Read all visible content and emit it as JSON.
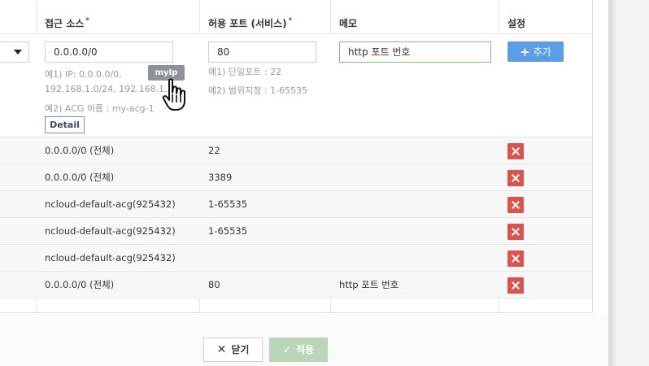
{
  "table": {
    "headers": {
      "source": "접근 소스",
      "port": "허용 포트 (서비스)",
      "memo": "메모",
      "settings": "설정"
    },
    "required_marker": "•"
  },
  "input_row": {
    "source_value": "0.0.0.0/0",
    "port_value": "80",
    "memo_value": "http 포트 번호",
    "source_hints": [
      "예1) IP: 0.0.0.0/0,",
      "192.168.1.0/24, 192.168.1.7",
      "예2) ACG 이름 : my-acg-1"
    ],
    "port_hints": [
      "예1) 단일포트 : 22",
      "예2) 범위지정 : 1-65535"
    ],
    "detail_label": "Detail",
    "add_label": "추가",
    "tooltip": "myIp"
  },
  "rows": [
    {
      "source": "0.0.0.0/0 (전체)",
      "port": "22",
      "memo": ""
    },
    {
      "source": "0.0.0.0/0 (전체)",
      "port": "3389",
      "memo": ""
    },
    {
      "source": "ncloud-default-acg(925432)",
      "port": "1-65535",
      "memo": ""
    },
    {
      "source": "ncloud-default-acg(925432)",
      "port": "1-65535",
      "memo": ""
    },
    {
      "source": "ncloud-default-acg(925432)",
      "port": "",
      "memo": ""
    },
    {
      "source": "0.0.0.0/0 (전체)",
      "port": "80",
      "memo": "http 포트 번호"
    }
  ],
  "footer": {
    "close_label": "닫기",
    "apply_label": "적용"
  },
  "colors": {
    "accent": "#5b9ee6",
    "delete": "#d9534f",
    "focus_border": "#7cc47c"
  }
}
